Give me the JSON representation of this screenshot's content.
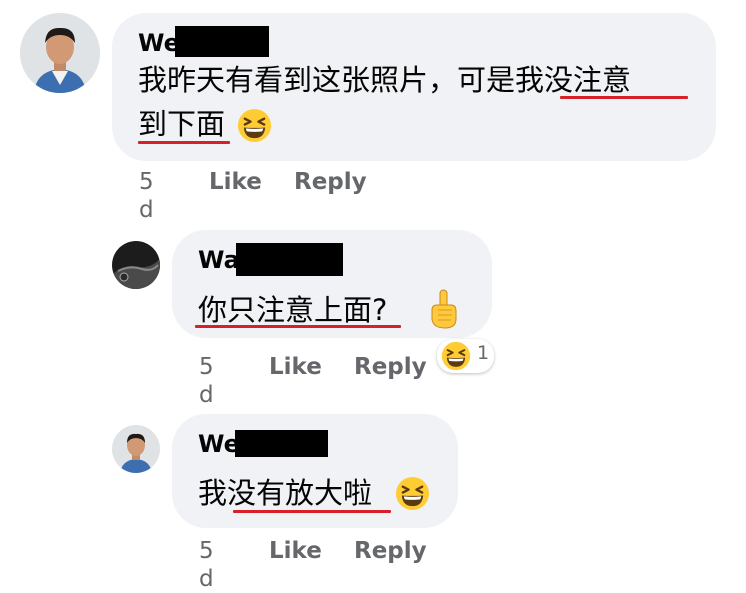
{
  "comments": [
    {
      "author_visible": "We",
      "lines": [
        "我昨天有看到这张照片，可是我没注意",
        "到下面"
      ],
      "emoji": "grinning-squinting-face",
      "time": "5 d",
      "like": "Like",
      "reply": "Reply"
    },
    {
      "author_visible": "Wa",
      "lines": [
        "你只注意上面?"
      ],
      "emoji": "pointing-up-hand",
      "time": "5 d",
      "like": "Like",
      "reply": "Reply",
      "reaction": {
        "emoji": "grinning-squinting-face",
        "count": "1"
      }
    },
    {
      "author_visible": "We",
      "lines": [
        "我没有放大啦"
      ],
      "emoji": "grinning-squinting-face",
      "time": "5 d",
      "like": "Like",
      "reply": "Reply"
    }
  ],
  "colors": {
    "bubble": "#f0f2f5",
    "underline": "#d6202a",
    "meta_text": "#65676b"
  }
}
